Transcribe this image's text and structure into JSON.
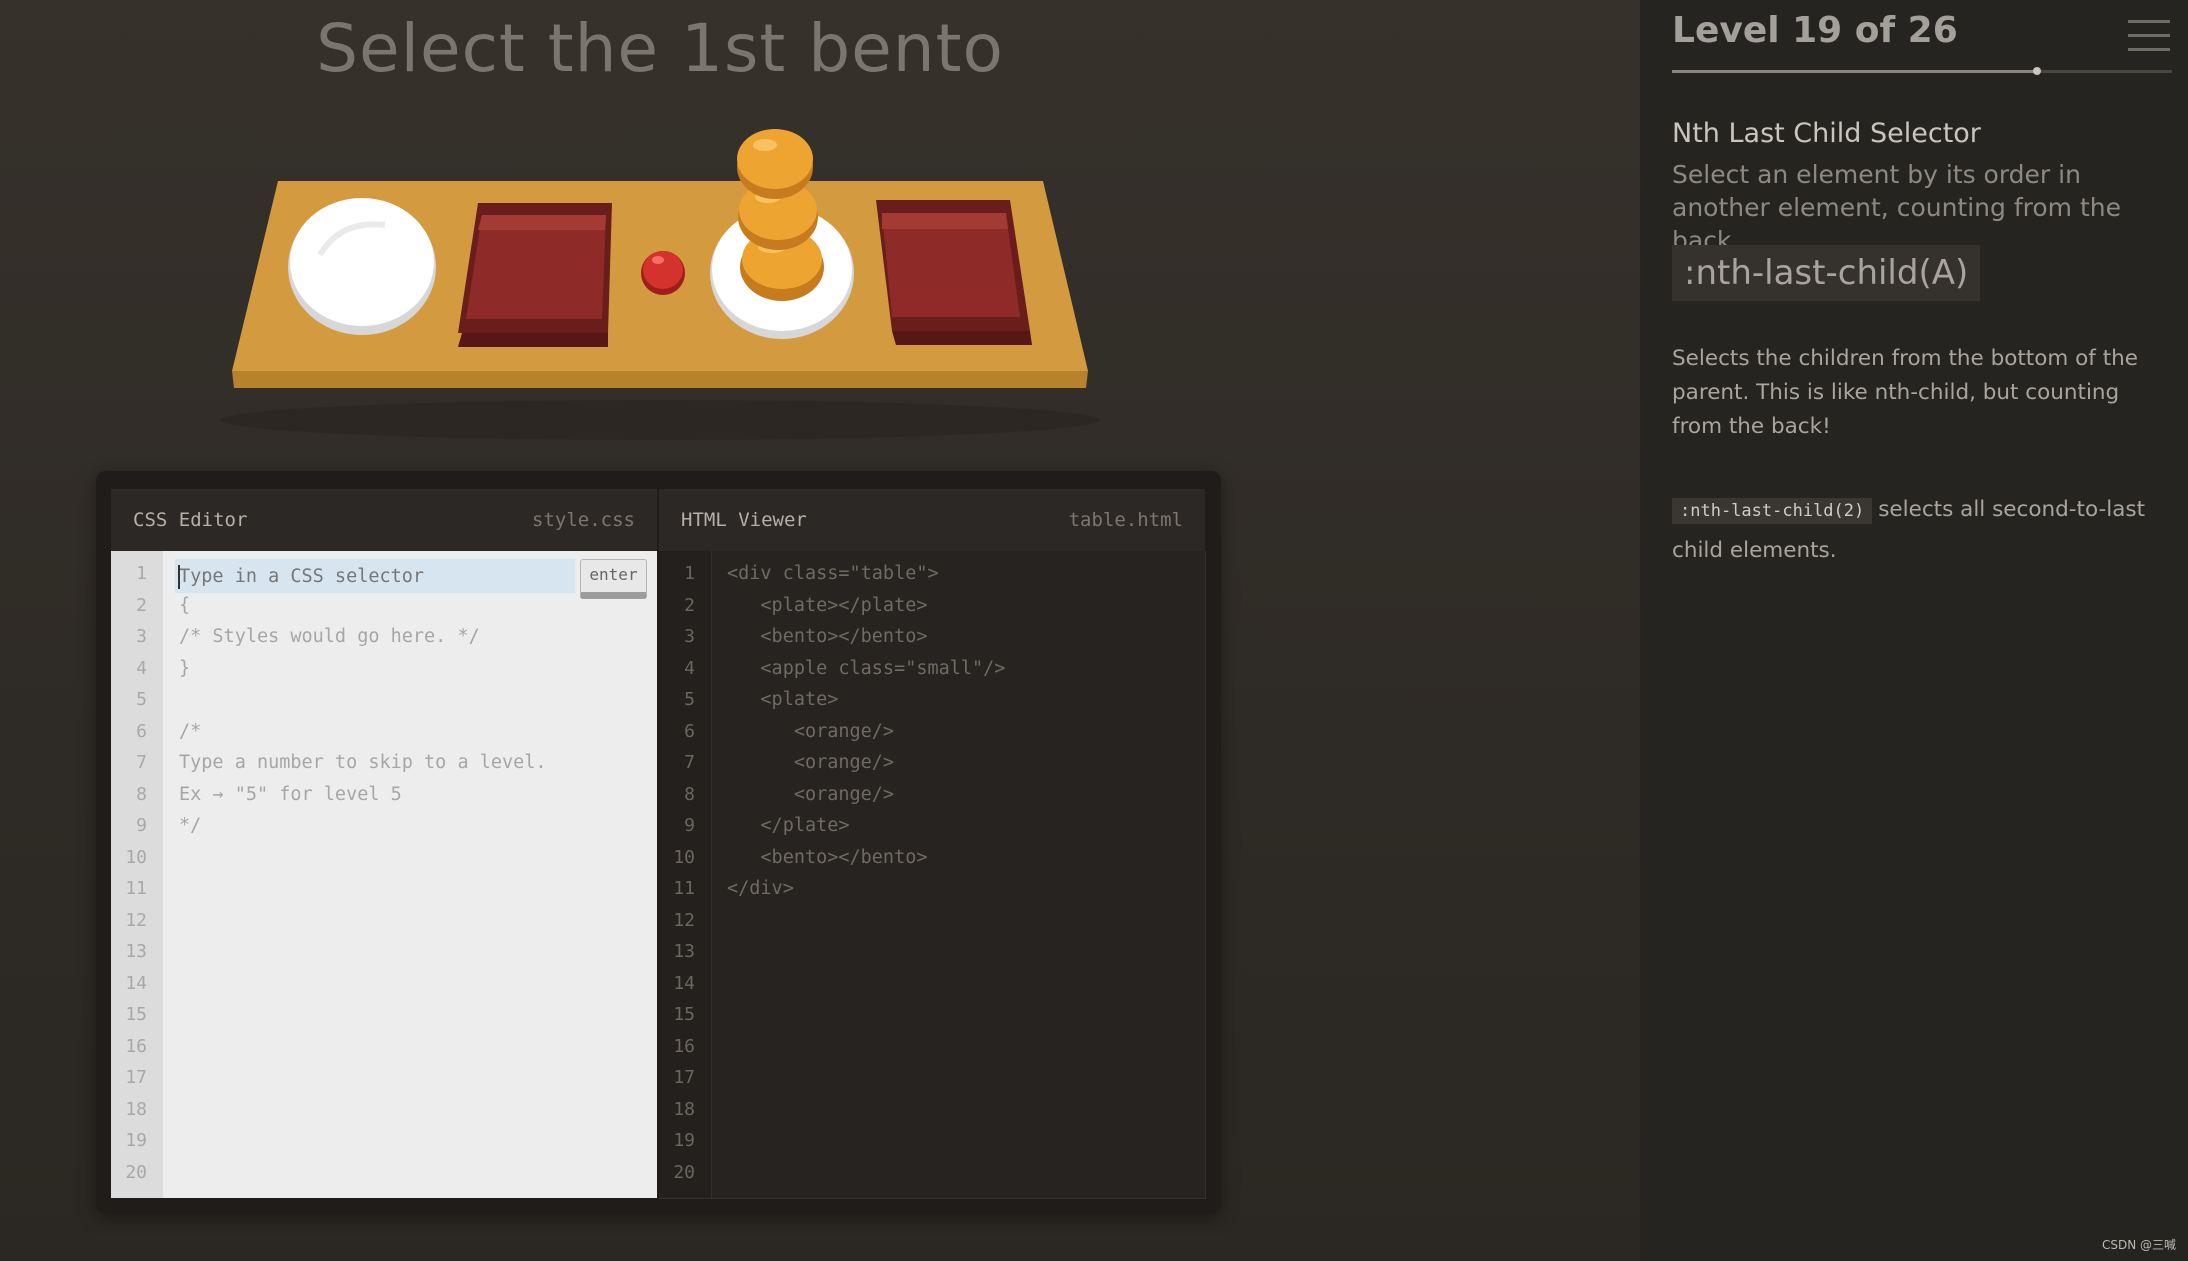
{
  "game": {
    "instruction": "Select the 1st bento"
  },
  "css_editor": {
    "title": "CSS Editor",
    "filename": "style.css",
    "input_placeholder": "Type in a CSS selector",
    "enter_label": "enter",
    "line_numbers": [
      "1",
      "2",
      "3",
      "4",
      "5",
      "6",
      "7",
      "8",
      "9",
      "10",
      "11",
      "12",
      "13",
      "14",
      "15",
      "16",
      "17",
      "18",
      "19",
      "20"
    ],
    "lines": [
      "",
      "{",
      "/* Styles would go here. */",
      "}",
      "",
      "/*",
      "Type a number to skip to a level.",
      "Ex → \"5\" for level 5",
      "*/"
    ]
  },
  "html_viewer": {
    "title": "HTML Viewer",
    "filename": "table.html",
    "line_numbers": [
      "1",
      "2",
      "3",
      "4",
      "5",
      "6",
      "7",
      "8",
      "9",
      "10",
      "11",
      "12",
      "13",
      "14",
      "15",
      "16",
      "17",
      "18",
      "19",
      "20"
    ],
    "lines": [
      "<div class=\"table\">",
      "   <plate></plate>",
      "   <bento></bento>",
      "   <apple class=\"small\"/>",
      "   <plate>",
      "      <orange/>",
      "      <orange/>",
      "      <orange/>",
      "   </plate>",
      "   <bento></bento>",
      "</div>"
    ]
  },
  "sidebar": {
    "level_title": "Level 19 of 26",
    "level_current": 19,
    "level_total": 26,
    "selector_name": "Nth Last Child Selector",
    "title": "Select an element by its order in another element, counting from the back",
    "syntax": ":nth-last-child(A)",
    "hint": "Selects the children from the bottom of the parent. This is like nth-child, but counting from the back!",
    "example_code": ":nth-last-child(2)",
    "example_text": "selects all second-to-last child elements."
  },
  "table_items": [
    "plate",
    "bento",
    "apple",
    "plate-with-oranges",
    "bento"
  ],
  "colors": {
    "background": "#332f2a",
    "table_wood": "#d39a3f",
    "bento": "#8e2a28",
    "apple": "#d3322d",
    "orange": "#eea431",
    "plate": "#ffffff"
  },
  "watermark": "CSDN @三喊"
}
